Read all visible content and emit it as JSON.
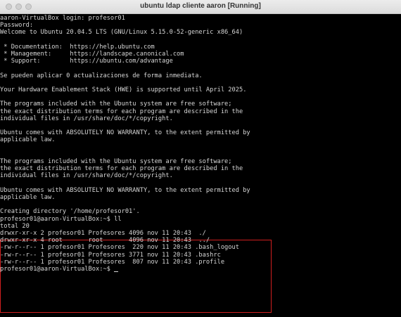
{
  "window": {
    "title": "ubuntu ldap cliente aaron [Running]"
  },
  "console": {
    "lines": [
      "aaron-VirtualBox login: profesor01",
      "Password:",
      "Welcome to Ubuntu 20.04.5 LTS (GNU/Linux 5.15.0-52-generic x86_64)",
      "",
      " * Documentation:  https://help.ubuntu.com",
      " * Management:     https://landscape.canonical.com",
      " * Support:        https://ubuntu.com/advantage",
      "",
      "Se pueden aplicar 0 actualizaciones de forma inmediata.",
      "",
      "Your Hardware Enablement Stack (HWE) is supported until April 2025.",
      "",
      "The programs included with the Ubuntu system are free software;",
      "the exact distribution terms for each program are described in the",
      "individual files in /usr/share/doc/*/copyright.",
      "",
      "Ubuntu comes with ABSOLUTELY NO WARRANTY, to the extent permitted by",
      "applicable law.",
      "",
      "",
      "The programs included with the Ubuntu system are free software;",
      "the exact distribution terms for each program are described in the",
      "individual files in /usr/share/doc/*/copyright.",
      "",
      "Ubuntu comes with ABSOLUTELY NO WARRANTY, to the extent permitted by",
      "applicable law.",
      "",
      "Creating directory '/home/profesor01'.",
      "profesor01@aaron-VirtualBox:~$ ll",
      "total 20",
      "drwxr-xr-x 2 profesor01 Profesores 4096 nov 11 20:43  ./",
      "drwxr-xr-x 4 root       root       4096 nov 11 20:43  ../",
      "-rw-r--r-- 1 profesor01 Profesores  220 nov 11 20:43 .bash_logout",
      "-rw-r--r-- 1 profesor01 Profesores 3771 nov 11 20:43 .bashrc",
      "-rw-r--r-- 1 profesor01 Profesores  807 nov 11 20:43 .profile",
      "profesor01@aaron-VirtualBox:~$ "
    ]
  },
  "colors": {
    "terminal_bg": "#000000",
    "terminal_text": "#d6d6d6",
    "highlight_border": "#d01f1f"
  }
}
